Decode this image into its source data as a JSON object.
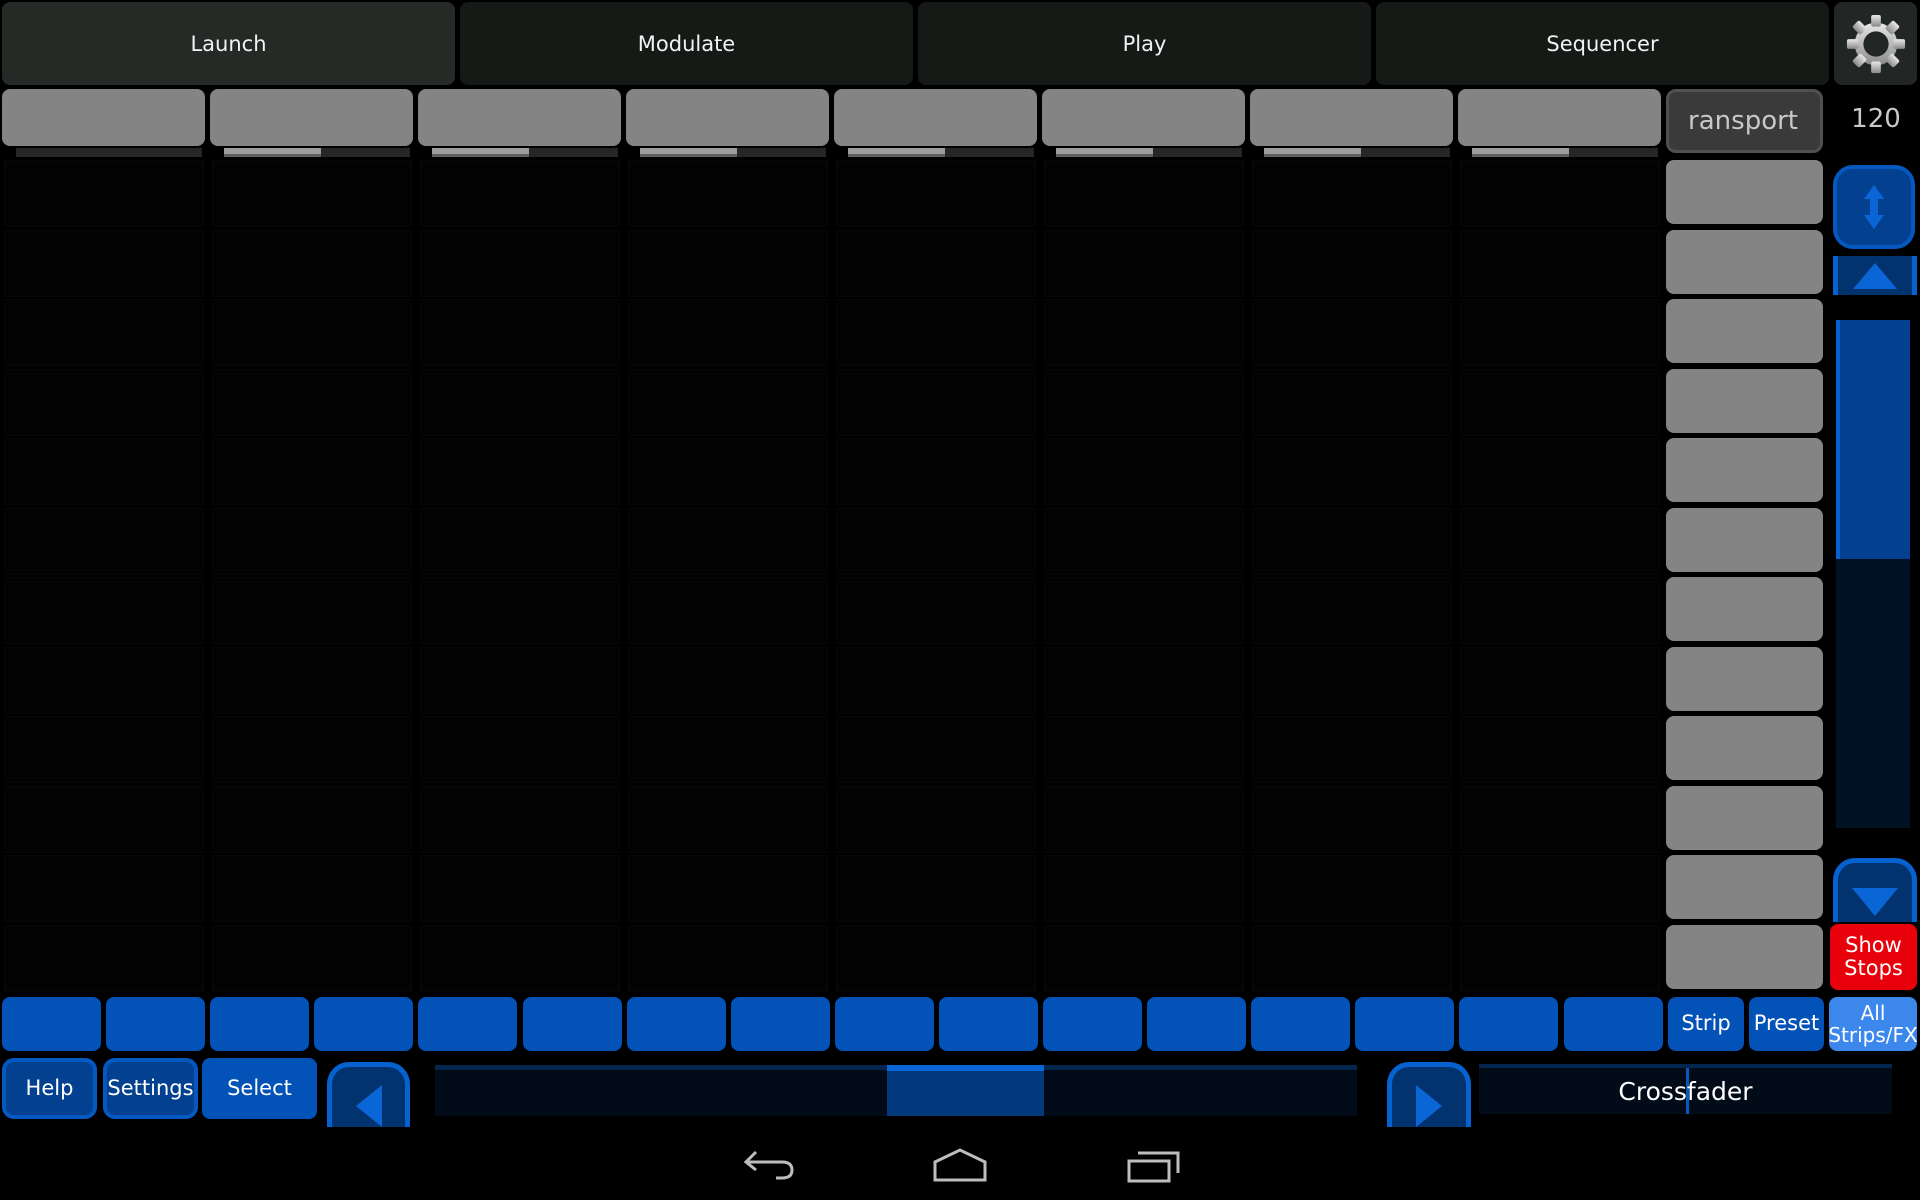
{
  "tabs": [
    {
      "label": "Launch",
      "active": true
    },
    {
      "label": "Modulate",
      "active": false
    },
    {
      "label": "Play",
      "active": false
    },
    {
      "label": "Sequencer",
      "active": false
    }
  ],
  "settings_icon": "gear-icon",
  "strips": {
    "count": 8,
    "meter_levels": [
      0,
      0.52,
      0.52,
      0.52,
      0.52,
      0.52,
      0.52,
      0.52
    ],
    "rows": 12
  },
  "transport": {
    "label": "ransport",
    "tempo": "120"
  },
  "scene_buttons_count": 12,
  "scroll": {
    "thumb_fraction_start": 0,
    "thumb_fraction_end": 0.47
  },
  "show_stops": {
    "label_line1": "Show",
    "label_line2": "Stops",
    "color": "#e8000b"
  },
  "bottom_pads_count": 16,
  "mode_buttons": {
    "strip": "Strip",
    "preset": "Preset",
    "all_line1": "All",
    "all_line2": "Strips/FX"
  },
  "footer": {
    "help": "Help",
    "settings": "Settings",
    "select": "Select"
  },
  "page_slider": {
    "start": 0.49,
    "end": 0.66
  },
  "crossfader": {
    "label": "Crossfader",
    "value": 0.5
  },
  "colors": {
    "accent": "#0352b8",
    "accent_light": "#3b87ec",
    "stop": "#e8000b"
  },
  "android_nav": [
    "back-icon",
    "home-icon",
    "recents-icon"
  ]
}
